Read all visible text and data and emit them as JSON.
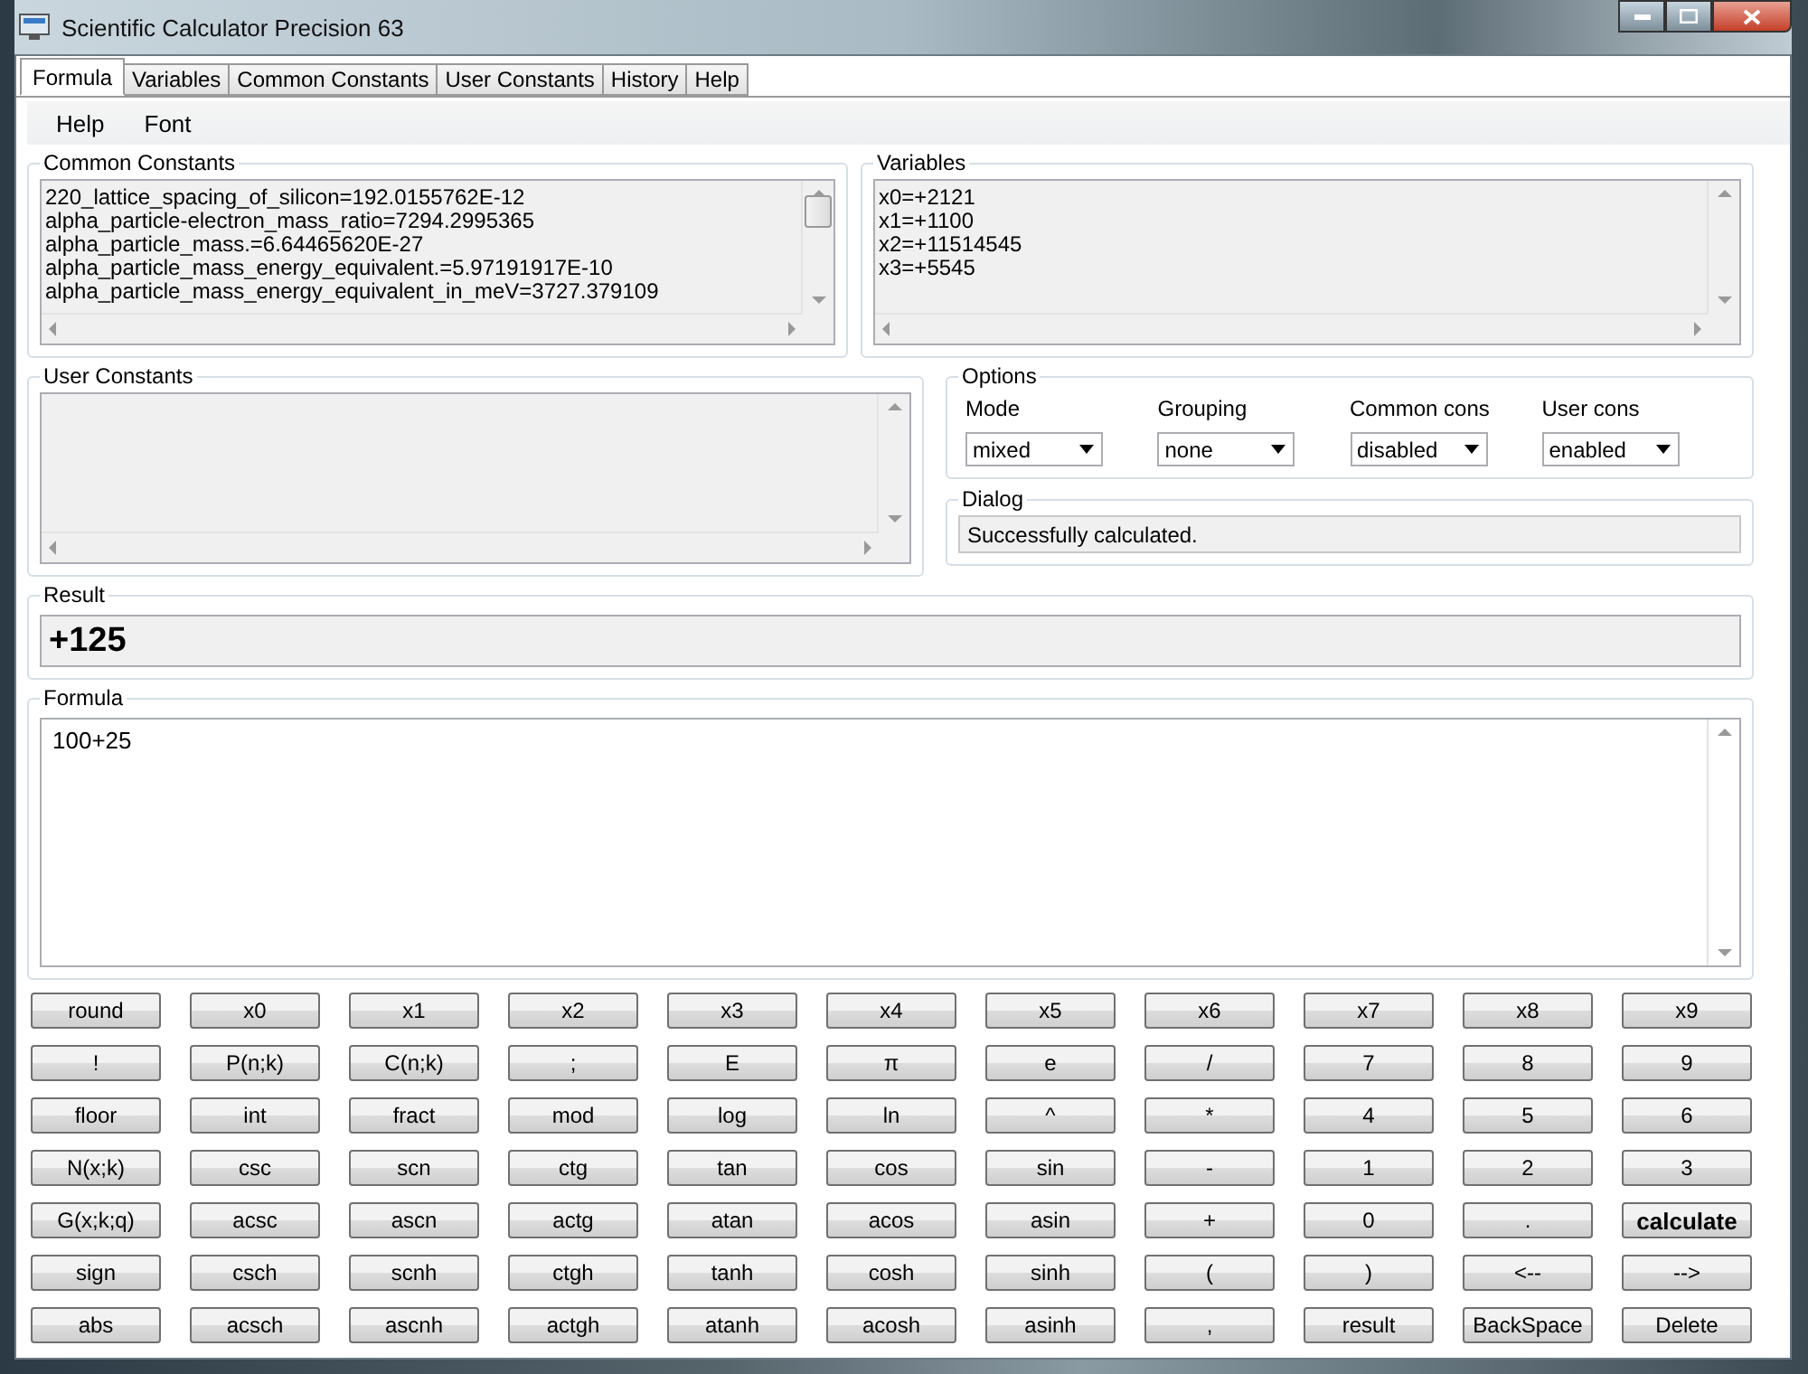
{
  "window": {
    "title": "Scientific Calculator Precision 63"
  },
  "tabs": [
    {
      "label": "Formula",
      "selected": true
    },
    {
      "label": "Variables",
      "selected": false
    },
    {
      "label": "Common Constants",
      "selected": false
    },
    {
      "label": "User Constants",
      "selected": false
    },
    {
      "label": "History",
      "selected": false
    },
    {
      "label": "Help",
      "selected": false
    }
  ],
  "menu": [
    "Help",
    "Font"
  ],
  "common_constants": {
    "title": "Common Constants",
    "lines": [
      "220_lattice_spacing_of_silicon=192.0155762E-12",
      "alpha_particle-electron_mass_ratio=7294.2995365",
      "alpha_particle_mass.=6.64465620E-27",
      "alpha_particle_mass_energy_equivalent.=5.97191917E-10",
      "alpha_particle_mass_energy_equivalent_in_meV=3727.379109"
    ]
  },
  "variables": {
    "title": "Variables",
    "lines": [
      "x0=+2121",
      "x1=+1100",
      "x2=+11514545",
      "x3=+5545"
    ]
  },
  "user_constants": {
    "title": "User Constants"
  },
  "options": {
    "title": "Options",
    "fields": [
      {
        "label": "Mode",
        "value": "mixed"
      },
      {
        "label": "Grouping",
        "value": "none"
      },
      {
        "label": "Common cons",
        "value": "disabled"
      },
      {
        "label": "User cons",
        "value": "enabled"
      }
    ]
  },
  "dialog": {
    "title": "Dialog",
    "message": "Successfully calculated."
  },
  "result": {
    "title": "Result",
    "value": "+125"
  },
  "formula": {
    "title": "Formula",
    "value": "100+25"
  },
  "keypad": [
    [
      {
        "label": "round",
        "kind": "normal"
      },
      {
        "label": "x0",
        "kind": "normal"
      },
      {
        "label": "x1",
        "kind": "normal"
      },
      {
        "label": "x2",
        "kind": "normal"
      },
      {
        "label": "x3",
        "kind": "normal"
      },
      {
        "label": "x4",
        "kind": "normal"
      },
      {
        "label": "x5",
        "kind": "normal"
      },
      {
        "label": "x6",
        "kind": "normal"
      },
      {
        "label": "x7",
        "kind": "normal"
      },
      {
        "label": "x8",
        "kind": "normal"
      },
      {
        "label": "x9",
        "kind": "normal"
      }
    ],
    [
      {
        "label": "!",
        "kind": "normal"
      },
      {
        "label": "P(n;k)",
        "kind": "normal"
      },
      {
        "label": "C(n;k)",
        "kind": "normal"
      },
      {
        "label": ";",
        "kind": "normal"
      },
      {
        "label": "E",
        "kind": "normal"
      },
      {
        "label": "π",
        "kind": "normal"
      },
      {
        "label": "e",
        "kind": "normal"
      },
      {
        "label": "/",
        "kind": "normal"
      },
      {
        "label": "7",
        "kind": "normal"
      },
      {
        "label": "8",
        "kind": "normal"
      },
      {
        "label": "9",
        "kind": "normal"
      }
    ],
    [
      {
        "label": "floor",
        "kind": "normal"
      },
      {
        "label": "int",
        "kind": "normal"
      },
      {
        "label": "fract",
        "kind": "normal"
      },
      {
        "label": "mod",
        "kind": "normal"
      },
      {
        "label": "log",
        "kind": "normal"
      },
      {
        "label": "ln",
        "kind": "normal"
      },
      {
        "label": "^",
        "kind": "normal"
      },
      {
        "label": "*",
        "kind": "normal"
      },
      {
        "label": "4",
        "kind": "normal"
      },
      {
        "label": "5",
        "kind": "normal"
      },
      {
        "label": "6",
        "kind": "normal"
      }
    ],
    [
      {
        "label": "N(x;k)",
        "kind": "normal"
      },
      {
        "label": "csc",
        "kind": "normal"
      },
      {
        "label": "scn",
        "kind": "normal"
      },
      {
        "label": "ctg",
        "kind": "normal"
      },
      {
        "label": "tan",
        "kind": "normal"
      },
      {
        "label": "cos",
        "kind": "normal"
      },
      {
        "label": "sin",
        "kind": "normal"
      },
      {
        "label": "-",
        "kind": "normal"
      },
      {
        "label": "1",
        "kind": "normal"
      },
      {
        "label": "2",
        "kind": "normal"
      },
      {
        "label": "3",
        "kind": "normal"
      }
    ],
    [
      {
        "label": "G(x;k;q)",
        "kind": "normal"
      },
      {
        "label": "acsc",
        "kind": "normal"
      },
      {
        "label": "ascn",
        "kind": "normal"
      },
      {
        "label": "actg",
        "kind": "normal"
      },
      {
        "label": "atan",
        "kind": "normal"
      },
      {
        "label": "acos",
        "kind": "normal"
      },
      {
        "label": "asin",
        "kind": "normal"
      },
      {
        "label": "+",
        "kind": "normal"
      },
      {
        "label": "0",
        "kind": "normal"
      },
      {
        "label": ".",
        "kind": "normal"
      },
      {
        "label": "calculate",
        "kind": "default"
      }
    ],
    [
      {
        "label": "sign",
        "kind": "normal"
      },
      {
        "label": "csch",
        "kind": "normal"
      },
      {
        "label": "scnh",
        "kind": "normal"
      },
      {
        "label": "ctgh",
        "kind": "normal"
      },
      {
        "label": "tanh",
        "kind": "normal"
      },
      {
        "label": "cosh",
        "kind": "normal"
      },
      {
        "label": "sinh",
        "kind": "normal"
      },
      {
        "label": "(",
        "kind": "normal"
      },
      {
        "label": ")",
        "kind": "normal"
      },
      {
        "label": "<--",
        "kind": "normal"
      },
      {
        "label": "-->",
        "kind": "normal"
      }
    ],
    [
      {
        "label": "abs",
        "kind": "normal"
      },
      {
        "label": "acsch",
        "kind": "normal"
      },
      {
        "label": "ascnh",
        "kind": "normal"
      },
      {
        "label": "actgh",
        "kind": "normal"
      },
      {
        "label": "atanh",
        "kind": "normal"
      },
      {
        "label": "acosh",
        "kind": "normal"
      },
      {
        "label": "asinh",
        "kind": "normal"
      },
      {
        "label": ",",
        "kind": "normal"
      },
      {
        "label": "result",
        "kind": "normal"
      },
      {
        "label": "BackSpace",
        "kind": "normal"
      },
      {
        "label": "Delete",
        "kind": "normal"
      }
    ]
  ]
}
